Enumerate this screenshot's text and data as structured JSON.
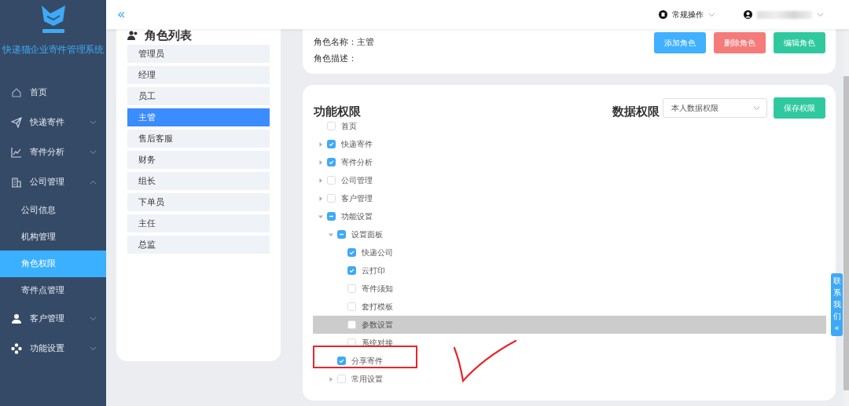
{
  "sidebar": {
    "app_title": "快递猫企业寄件管理系统",
    "items": [
      {
        "label": "首页",
        "selected": false
      },
      {
        "label": "快递寄件",
        "expanded": false,
        "selected": false
      },
      {
        "label": "寄件分析",
        "expanded": false,
        "selected": false
      },
      {
        "label": "公司管理",
        "expanded": true,
        "selected": false,
        "children": [
          {
            "label": "公司信息",
            "selected": false
          },
          {
            "label": "机构管理",
            "selected": false
          },
          {
            "label": "角色权限",
            "selected": true
          },
          {
            "label": "寄件点管理",
            "selected": false
          }
        ]
      },
      {
        "label": "客户管理",
        "expanded": false,
        "selected": false
      },
      {
        "label": "功能设置",
        "expanded": false,
        "selected": false
      }
    ]
  },
  "header": {
    "collapse_icon": "«",
    "quick_menu": "常规操作"
  },
  "role_list": {
    "title": "角色列表",
    "roles": [
      {
        "label": "管理员",
        "selected": false
      },
      {
        "label": "经理",
        "selected": false
      },
      {
        "label": "员工",
        "selected": false
      },
      {
        "label": "主管",
        "selected": true
      },
      {
        "label": "售后客服",
        "selected": false
      },
      {
        "label": "财务",
        "selected": false
      },
      {
        "label": "组长",
        "selected": false
      },
      {
        "label": "下单员",
        "selected": false
      },
      {
        "label": "主任",
        "selected": false
      },
      {
        "label": "总监",
        "selected": false
      }
    ]
  },
  "role_info": {
    "fields": [
      {
        "label": "角色名称：",
        "value": "主管"
      },
      {
        "label": "角色描述："
      }
    ],
    "buttons": [
      {
        "label": "添加角色",
        "kind": "primary"
      },
      {
        "label": "删除角色",
        "kind": "danger"
      },
      {
        "label": "编辑角色",
        "kind": "success"
      }
    ]
  },
  "permissions": {
    "title": "功能权限",
    "data_label": "数据权限",
    "data_scope": "本人数据权限",
    "save_button": "保存权限",
    "tree": [
      {
        "label": "首页",
        "checked": false
      },
      {
        "label": "快递寄件",
        "checked": true,
        "expanded": false
      },
      {
        "label": "寄件分析",
        "checked": true,
        "expanded": false
      },
      {
        "label": "公司管理",
        "checked": false,
        "expanded": false
      },
      {
        "label": "客户管理",
        "checked": false,
        "expanded": false
      },
      {
        "label": "功能设置",
        "indeterminate": true,
        "expanded": true,
        "children": [
          {
            "label": "设置面板",
            "indeterminate": true,
            "expanded": true,
            "children": [
              {
                "label": "快递公司",
                "checked": true
              },
              {
                "label": "云打印",
                "checked": true
              },
              {
                "label": "寄件须知",
                "checked": false
              },
              {
                "label": "套打模板",
                "checked": false
              },
              {
                "label": "参数设置",
                "checked": false,
                "hovered": true
              },
              {
                "label": "系统对接",
                "checked": false
              }
            ]
          },
          {
            "label": "分享寄件",
            "checked": true,
            "annotated": true
          },
          {
            "label": "常用设置",
            "checked": false,
            "expanded": false
          }
        ]
      }
    ]
  },
  "contact_tab": {
    "label": "联系我们",
    "arrow": "«"
  }
}
